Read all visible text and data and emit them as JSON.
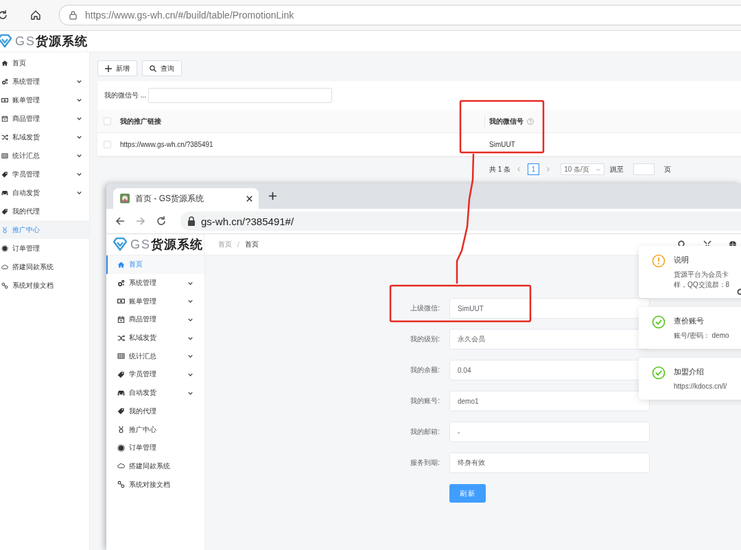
{
  "browser": {
    "url": "https://www.gs-wh.cn/#/build/table/PromotionLink"
  },
  "app": {
    "logo": "GS**货源系统**"
  },
  "sidebar": {
    "items": [
      {
        "label": "首页",
        "expandable": false,
        "selected": false
      },
      {
        "label": "系统管理",
        "expandable": true,
        "selected": false
      },
      {
        "label": "账单管理",
        "expandable": true,
        "selected": false
      },
      {
        "label": "商品管理",
        "expandable": true,
        "selected": false
      },
      {
        "label": "私域发货",
        "expandable": true,
        "selected": false
      },
      {
        "label": "统计汇总",
        "expandable": true,
        "selected": false
      },
      {
        "label": "学员管理",
        "expandable": true,
        "selected": false
      },
      {
        "label": "自动发货",
        "expandable": true,
        "selected": false
      },
      {
        "label": "我的代理",
        "expandable": false,
        "selected": false
      },
      {
        "label": "推广中心",
        "expandable": false,
        "selected": true
      },
      {
        "label": "订单管理",
        "expandable": false,
        "selected": false
      },
      {
        "label": "搭建同款系统",
        "expandable": false,
        "selected": false
      },
      {
        "label": "系统对接文档",
        "expandable": false,
        "selected": false
      }
    ]
  },
  "toolbar": {
    "buttons": [
      {
        "kind": "add",
        "label": "新增"
      },
      {
        "kind": "search",
        "label": "查询"
      }
    ]
  },
  "filter": {
    "label": "我的微信号 ..."
  },
  "table": {
    "header_checked": false,
    "columns": [
      {
        "label": "我的推广链接",
        "help": false
      },
      {
        "label": "我的微信号",
        "help": true
      }
    ],
    "rows": [
      {
        "selected": false,
        "cells": [
          "https://www.gs-wh.cn/?385491",
          "SimUUT"
        ]
      }
    ]
  },
  "pagination": {
    "total": "共 1 条",
    "pages": [
      {
        "label": "1",
        "selected": true
      }
    ],
    "page_size": "10 条/页",
    "jump_label": "跳至",
    "page_suffix": "页"
  },
  "popup_window": {
    "tab": {
      "title": "首页 - GS货源系统"
    },
    "url": "gs-wh.cn/?385491#/",
    "logo": "GS**货源系统**",
    "breadcrumb": [
      "首页",
      "首页"
    ],
    "breadcrumb_separator": "/",
    "sidebar": {
      "items": [
        {
          "label": "首页",
          "expandable": false,
          "selected": true
        },
        {
          "label": "系统管理",
          "expandable": true,
          "selected": false
        },
        {
          "label": "账单管理",
          "expandable": true,
          "selected": false
        },
        {
          "label": "商品管理",
          "expandable": true,
          "selected": false
        },
        {
          "label": "私域发货",
          "expandable": true,
          "selected": false
        },
        {
          "label": "统计汇总",
          "expandable": true,
          "selected": false
        },
        {
          "label": "学员管理",
          "expandable": true,
          "selected": false
        },
        {
          "label": "自动发货",
          "expandable": true,
          "selected": false
        },
        {
          "label": "我的代理",
          "expandable": false,
          "selected": false
        },
        {
          "label": "推广中心",
          "expandable": false,
          "selected": false
        },
        {
          "label": "订单管理",
          "expandable": false,
          "selected": false
        },
        {
          "label": "搭建同款系统",
          "expandable": false,
          "selected": false
        },
        {
          "label": "系统对接文档",
          "expandable": false,
          "selected": false
        }
      ]
    },
    "form": {
      "fields": [
        {
          "label": "上级微信:",
          "value": "SimUUT"
        },
        {
          "label": "我的级别:",
          "value": "永久会员"
        },
        {
          "label": "我的余额:",
          "value": "0.04"
        },
        {
          "label": "我的账号:",
          "value": "demo1"
        },
        {
          "label": "我的邮箱:",
          "value": "-"
        },
        {
          "label": "服务到期:",
          "value": "终身有效"
        }
      ],
      "button": "刷新"
    },
    "notifications": [
      {
        "kind": "warning",
        "title": "说明",
        "lines": [
          "货源平台为会员卡",
          "样，QQ交流群：8"
        ]
      },
      {
        "kind": "success",
        "title": "查价账号",
        "lines": [
          "账号/密码： demo"
        ]
      },
      {
        "kind": "success",
        "title": "加盟介绍",
        "lines": [
          "https://kdocs.cn/l/"
        ]
      }
    ]
  },
  "annotations": [
    {
      "kind": "box"
    },
    {
      "kind": "connector"
    },
    {
      "kind": "box"
    }
  ]
}
